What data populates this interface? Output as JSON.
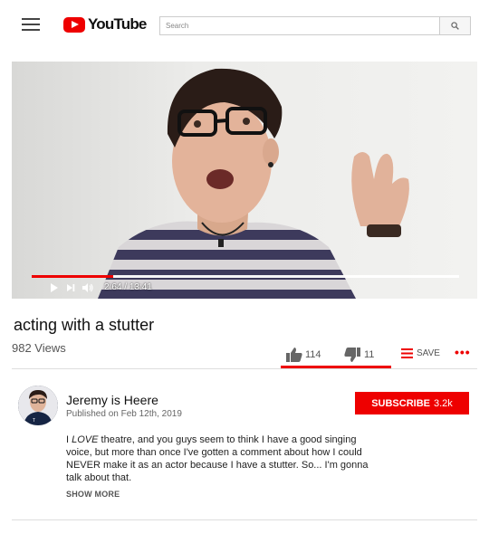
{
  "header": {
    "logo_text": "YouTube",
    "search_placeholder": "Search"
  },
  "player": {
    "current_time": "2:64",
    "duration": "13:41",
    "progress_fraction": 0.19
  },
  "video": {
    "title": "acting with a stutter",
    "views": "982 Views",
    "likes": "114",
    "dislikes": "11",
    "save_label": "SAVE",
    "more_label": "•••"
  },
  "channel": {
    "name": "Jeremy is Heere",
    "published": "Published on Feb 12th, 2019",
    "subscribe_label": "SUBSCRIBE",
    "subscriber_count": "3.2k"
  },
  "description": {
    "part1": "I ",
    "emphasis": "LOVE",
    "part2": " theatre, and you guys seem to think I have a good singing voice, but more than once I've gotten a comment about how I could NEVER make it as an actor because I have a stutter. So... I'm gonna talk about that.",
    "show_more": "SHOW MORE"
  },
  "colors": {
    "brand_red": "#ee0000",
    "text_gray": "#555555"
  }
}
